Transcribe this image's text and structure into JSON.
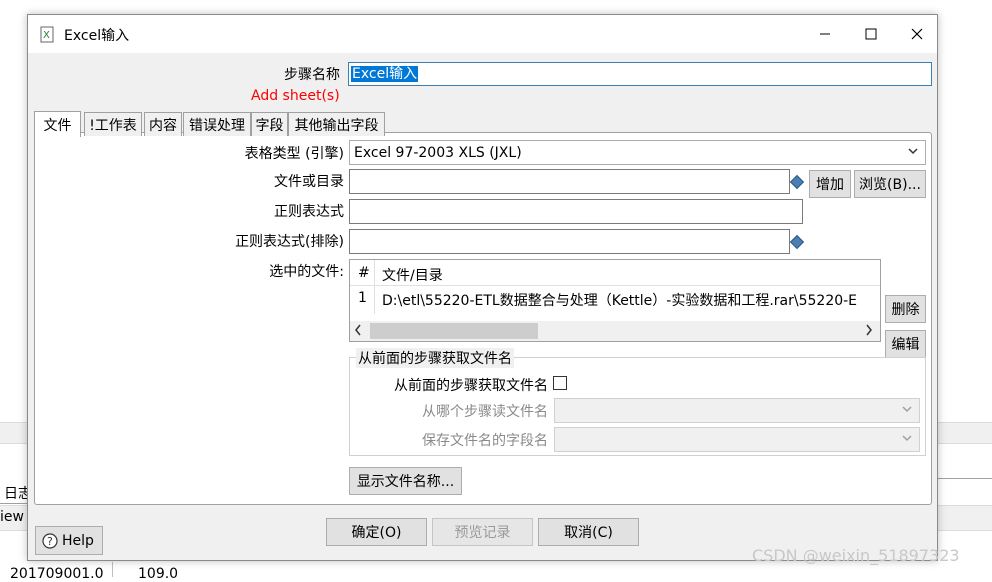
{
  "background": {
    "log_tab": "日志",
    "preview_tab": "iew",
    "row_cell_1": "201709001.0",
    "row_cell_2": "109.0"
  },
  "dialog": {
    "title": "Excel输入",
    "step_name_label": "步骤名称",
    "step_name_value": "Excel输入",
    "warning": "Add sheet(s)",
    "tabs": [
      "文件",
      "!工作表",
      "内容",
      "错误处理",
      "字段",
      "其他输出字段"
    ],
    "file_tab": {
      "table_type_label": "表格类型 (引擎)",
      "table_type_value": "Excel 97-2003 XLS (JXL)",
      "file_or_dir_label": "文件或目录",
      "file_or_dir_value": "",
      "add_button": "增加",
      "browse_button": "浏览(B)...",
      "regex_label": "正则表达式",
      "regex_value": "",
      "regex_exclude_label": "正则表达式(排除)",
      "regex_exclude_value": "",
      "selected_files_label": "选中的文件:",
      "table": {
        "headers": [
          "#",
          "文件/目录"
        ],
        "rows": [
          [
            "1",
            "D:\\etl\\55220-ETL数据整合与处理（Kettle）-实验数据和工程.rar\\55220-E"
          ]
        ]
      },
      "delete_button": "删除",
      "edit_button": "编辑",
      "group_title": "从前面的步骤获取文件名",
      "from_prev_checkbox_label": "从前面的步骤获取文件名",
      "from_prev_checked": false,
      "read_from_step_label": "从哪个步骤读文件名",
      "save_field_label": "保存文件名的字段名",
      "show_filenames_button": "显示文件名称..."
    },
    "help_button": "Help",
    "ok_button": "确定(O)",
    "preview_button": "预览记录",
    "cancel_button": "取消(C)"
  },
  "watermark": "CSDN @weixin_51897323",
  "colors": {
    "warning": "#ff0000",
    "selection": "#0078d7",
    "dialog_bg": "#f0f0f0"
  }
}
